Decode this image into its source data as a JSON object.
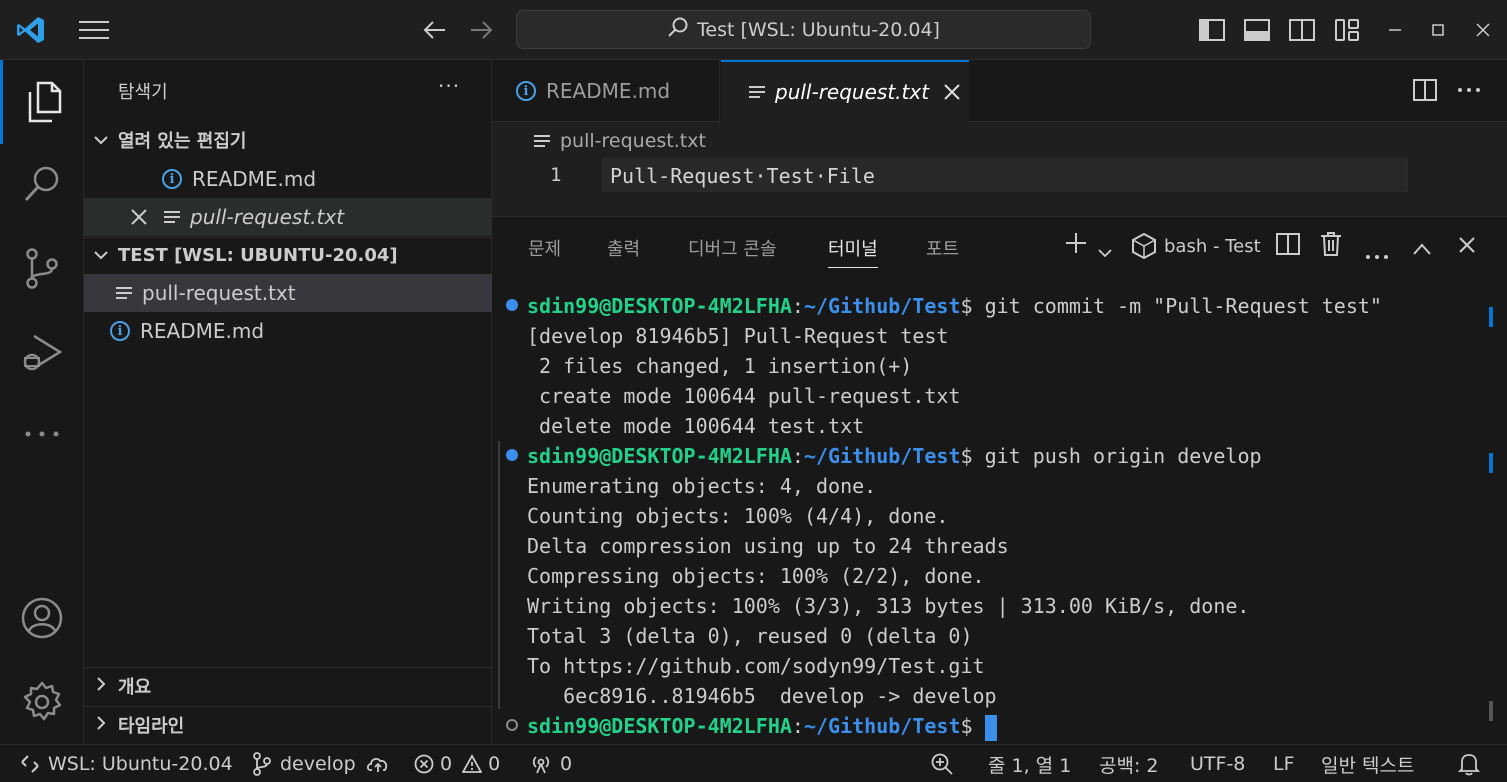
{
  "titlebar": {
    "title": "Test [WSL: Ubuntu-20.04]"
  },
  "sidebar": {
    "title": "탐색기",
    "more": "···",
    "open_editors": {
      "label": "열려 있는 편집기",
      "items": [
        {
          "name": "README.md"
        },
        {
          "name": "pull-request.txt"
        }
      ]
    },
    "workspace": {
      "label": "TEST [WSL: UBUNTU-20.04]",
      "items": [
        {
          "name": "pull-request.txt"
        },
        {
          "name": "README.md"
        }
      ]
    },
    "outline": "개요",
    "timeline": "타임라인"
  },
  "tabs": [
    {
      "label": "README.md"
    },
    {
      "label": "pull-request.txt"
    }
  ],
  "breadcrumb": "pull-request.txt",
  "editor": {
    "line_number": "1",
    "line_text": "Pull-Request·Test·File"
  },
  "panel": {
    "tabs": [
      "문제",
      "출력",
      "디버그 콘솔",
      "터미널",
      "포트"
    ],
    "terminal_name": "bash - Test",
    "terminal": {
      "user": "sdin99@DESKTOP-4M2LFHA",
      "path": "~/Github/Test",
      "cmd1": "git commit -m \"Pull-Request test\"",
      "out1": [
        "[develop 81946b5] Pull-Request test",
        " 2 files changed, 1 insertion(+)",
        " create mode 100644 pull-request.txt",
        " delete mode 100644 test.txt"
      ],
      "cmd2": "git push origin develop",
      "out2": [
        "Enumerating objects: 4, done.",
        "Counting objects: 100% (4/4), done.",
        "Delta compression using up to 24 threads",
        "Compressing objects: 100% (2/2), done.",
        "Writing objects: 100% (3/3), 313 bytes | 313.00 KiB/s, done.",
        "Total 3 (delta 0), reused 0 (delta 0)",
        "To https://github.com/sodyn99/Test.git",
        "   6ec8916..81946b5  develop -> develop"
      ]
    }
  },
  "statusbar": {
    "remote": "WSL: Ubuntu-20.04",
    "branch": "develop",
    "errors": "0",
    "warnings": "0",
    "ports": "0",
    "position": "줄 1, 열 1",
    "spaces": "공백: 2",
    "encoding": "UTF-8",
    "eol": "LF",
    "language": "일반 텍스트"
  },
  "colors": {
    "accent": "#0078d4",
    "terminal_user": "#23d18b",
    "terminal_path": "#3b8eea",
    "info_icon": "#4aa0e6"
  }
}
